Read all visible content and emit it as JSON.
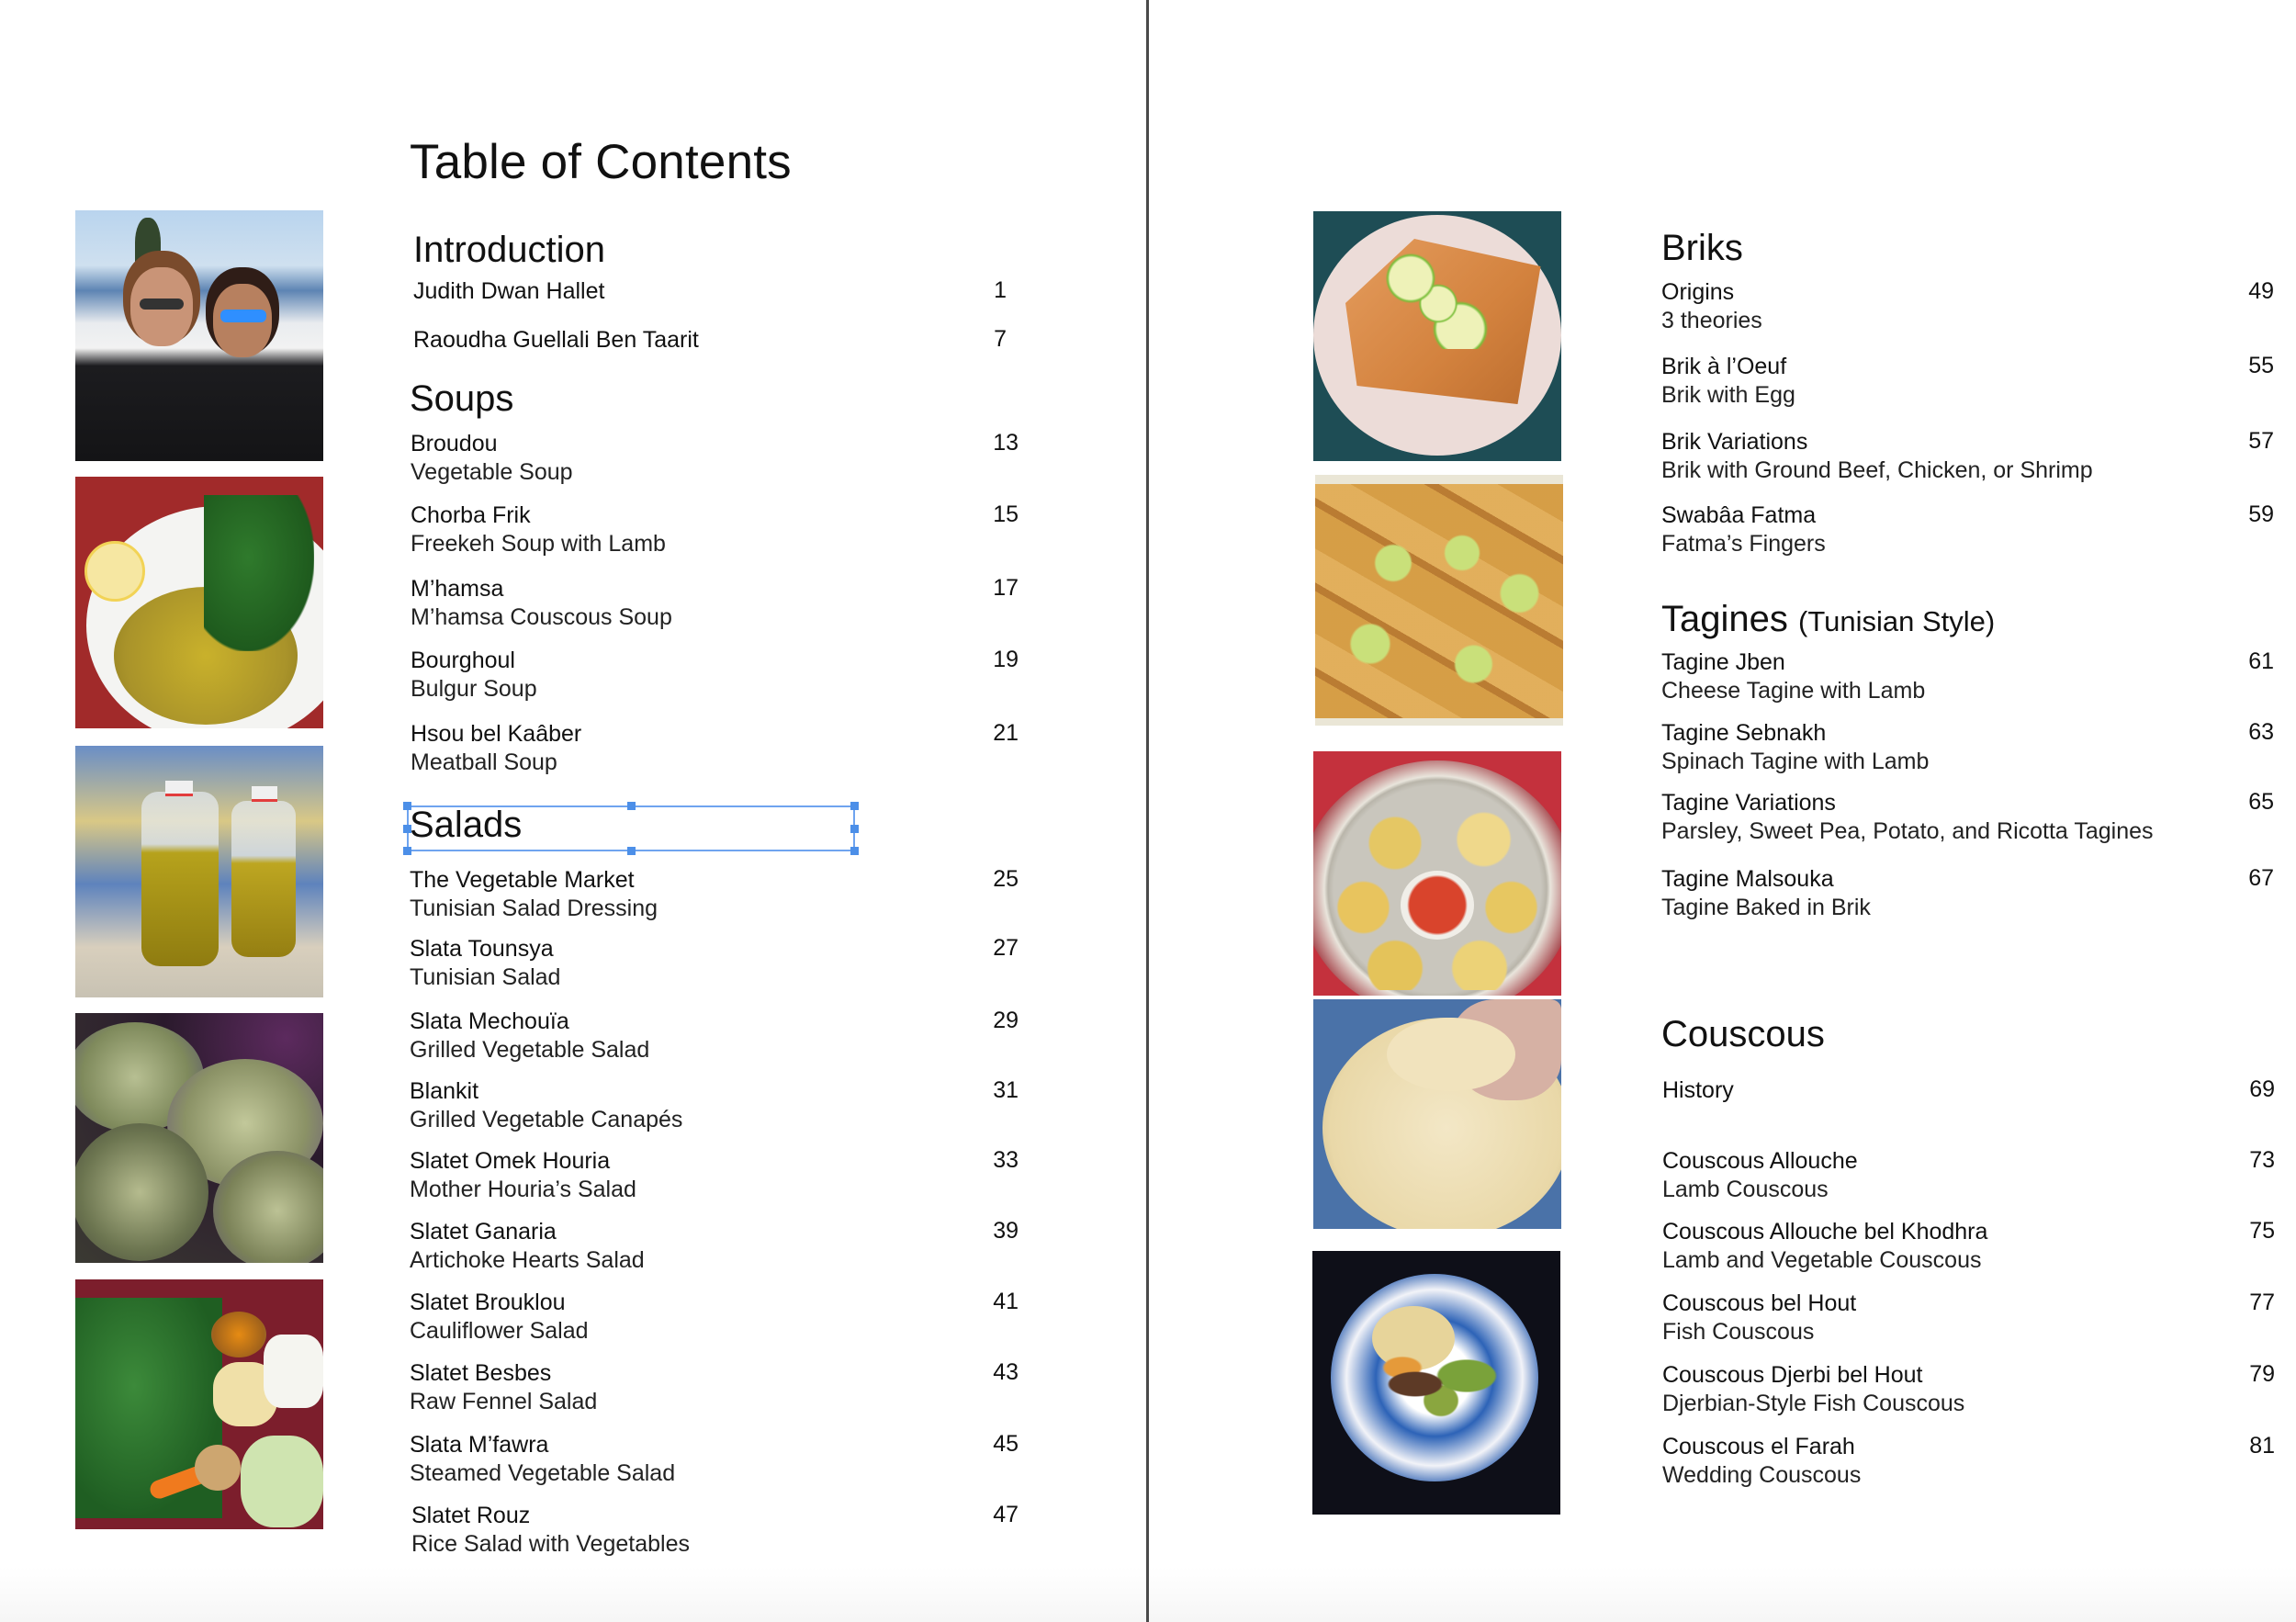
{
  "document": {
    "title": "Table of Contents"
  },
  "selection": {
    "selected_element": "Salads"
  },
  "photos": {
    "left": [
      {
        "icon": "photo-authors",
        "description": "Two women smiling on a terrace with sea view"
      },
      {
        "icon": "photo-soup",
        "description": "Bowl of soup with lemon and parsley"
      },
      {
        "icon": "photo-olive-oil",
        "description": "Bottles of olive oil on tiles"
      },
      {
        "icon": "photo-artichokes",
        "description": "Pile of artichokes"
      },
      {
        "icon": "photo-vegetables",
        "description": "Plate of fresh vegetables and spices"
      }
    ],
    "right": [
      {
        "icon": "photo-brik",
        "description": "Brik pastries with lime slices"
      },
      {
        "icon": "photo-brik-fingers",
        "description": "Rolled brik fingers with limes"
      },
      {
        "icon": "photo-tagine",
        "description": "Tagine squares with dipping sauce"
      },
      {
        "icon": "photo-couscous-grain",
        "description": "Hand holding couscous grain"
      },
      {
        "icon": "photo-couscous-plate",
        "description": "Couscous plate with vegetables"
      }
    ]
  },
  "sections": {
    "introduction": {
      "heading": "Introduction",
      "entries": [
        {
          "title": "Judith Dwan Hallet",
          "subtitle": "",
          "page": "1"
        },
        {
          "title": "Raoudha Guellali Ben Taarit",
          "subtitle": "",
          "page": "7"
        }
      ]
    },
    "soups": {
      "heading": "Soups",
      "entries": [
        {
          "title": "Broudou",
          "subtitle": "Vegetable Soup",
          "page": "13"
        },
        {
          "title": "Chorba Frik",
          "subtitle": "Freekeh Soup with Lamb",
          "page": "15"
        },
        {
          "title": "M’hamsa",
          "subtitle": "M’hamsa Couscous Soup",
          "page": "17"
        },
        {
          "title": "Bourghoul",
          "subtitle": "Bulgur Soup",
          "page": "19"
        },
        {
          "title": "Hsou bel Kaâber",
          "subtitle": "Meatball Soup",
          "page": "21"
        }
      ]
    },
    "salads": {
      "heading": "Salads",
      "entries": [
        {
          "title": "The Vegetable Market",
          "subtitle": "Tunisian Salad Dressing",
          "page": "25"
        },
        {
          "title": "Slata Tounsya",
          "subtitle": "Tunisian Salad",
          "page": "27"
        },
        {
          "title": "Slata Mechouïa",
          "subtitle": "Grilled Vegetable Salad",
          "page": "29"
        },
        {
          "title": "Blankit",
          "subtitle": "Grilled Vegetable Canapés",
          "page": "31"
        },
        {
          "title": "Slatet Omek Houria",
          "subtitle": "Mother Houria’s Salad",
          "page": "33"
        },
        {
          "title": "Slatet Ganaria",
          "subtitle": "Artichoke Hearts Salad",
          "page": "39"
        },
        {
          "title": "Slatet Brouklou",
          "subtitle": "Cauliflower Salad",
          "page": "41"
        },
        {
          "title": "Slatet Besbes",
          "subtitle": "Raw Fennel Salad",
          "page": "43"
        },
        {
          "title": "Slata M’fawra",
          "subtitle": "Steamed Vegetable Salad",
          "page": "45"
        },
        {
          "title": "Slatet Rouz",
          "subtitle": "Rice Salad with Vegetables",
          "page": "47"
        }
      ]
    },
    "briks": {
      "heading": "Briks",
      "entries": [
        {
          "title": "Origins",
          "subtitle": "3 theories",
          "page": "49"
        },
        {
          "title": "Brik à l’Oeuf",
          "subtitle": "Brik with Egg",
          "page": "55"
        },
        {
          "title": "Brik Variations",
          "subtitle": "Brik with Ground Beef, Chicken, or Shrimp",
          "page": "57"
        },
        {
          "title": "Swabâa Fatma",
          "subtitle": "Fatma’s Fingers",
          "page": "59"
        }
      ]
    },
    "tagines": {
      "heading": "Tagines",
      "heading_sub": "(Tunisian Style)",
      "entries": [
        {
          "title": "Tagine Jben",
          "subtitle": "Cheese Tagine with Lamb",
          "page": "61"
        },
        {
          "title": "Tagine Sebnakh",
          "subtitle": "Spinach Tagine with Lamb",
          "page": "63"
        },
        {
          "title": "Tagine Variations",
          "subtitle": "Parsley, Sweet Pea, Potato, and Ricotta Tagines",
          "page": "65"
        },
        {
          "title": "Tagine Malsouka",
          "subtitle": "Tagine Baked in Brik",
          "page": "67"
        }
      ]
    },
    "couscous": {
      "heading": "Couscous",
      "entries": [
        {
          "title": "History",
          "subtitle": "",
          "page": "69"
        },
        {
          "title": "Couscous Allouche",
          "subtitle": "Lamb Couscous",
          "page": "73"
        },
        {
          "title": "Couscous Allouche bel Khodhra",
          "subtitle": "Lamb and Vegetable Couscous",
          "page": "75"
        },
        {
          "title": "Couscous bel Hout",
          "subtitle": "Fish Couscous",
          "page": "77"
        },
        {
          "title": "Couscous Djerbi bel Hout",
          "subtitle": "Djerbian-Style Fish Couscous",
          "page": "79"
        },
        {
          "title": "Couscous el Farah",
          "subtitle": "Wedding Couscous",
          "page": "81"
        }
      ]
    }
  },
  "colors": {
    "selection_outline": "#6fa4ef",
    "selection_handle": "#4c8fe8",
    "spine": "#4a4a4a"
  }
}
